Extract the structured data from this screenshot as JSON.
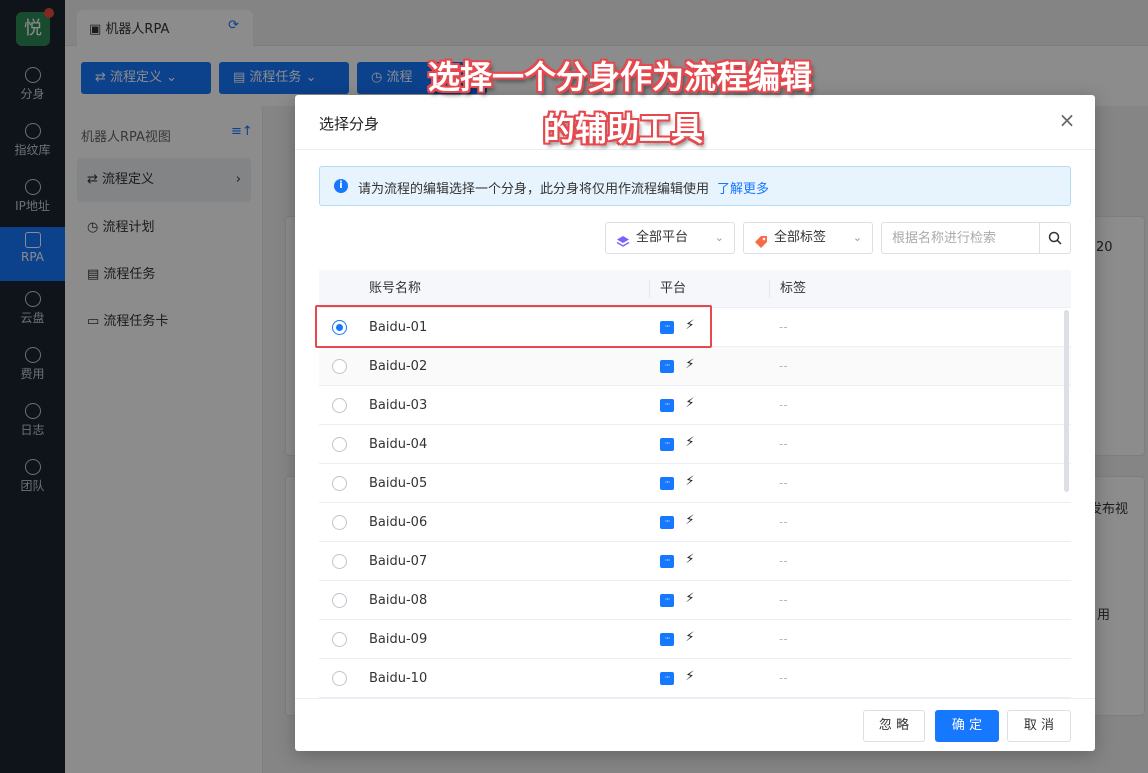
{
  "leftnav": {
    "logo": "悦",
    "items": [
      {
        "label": "分身",
        "icon": "chrome-icon"
      },
      {
        "label": "指纹库",
        "icon": "fingerprint-icon"
      },
      {
        "label": "IP地址",
        "icon": "ip-icon"
      },
      {
        "label": "RPA",
        "icon": "robot-icon",
        "active": true
      },
      {
        "label": "云盘",
        "icon": "cloud-icon"
      },
      {
        "label": "费用",
        "icon": "yen-icon"
      },
      {
        "label": "日志",
        "icon": "log-icon"
      },
      {
        "label": "团队",
        "icon": "team-icon"
      }
    ]
  },
  "tabbar": {
    "tab_label": "机器人RPA"
  },
  "toolbar": {
    "btn1": "流程定义",
    "btn2": "流程任务",
    "btn3": "流程"
  },
  "sidepanel": {
    "title": "机器人RPA视图",
    "items": [
      "流程定义",
      "流程计划",
      "流程任务",
      "流程任务卡"
    ]
  },
  "background_fragments": {
    "t1": "20",
    "t2": "发布视",
    "t3": "用"
  },
  "modal": {
    "title": "选择分身",
    "close": "×",
    "alert_text": "请为流程的编辑选择一个分身，此分身将仅用作流程编辑使用",
    "alert_link": "了解更多",
    "filter_platform": "全部平台",
    "filter_tag": "全部标签",
    "search_placeholder": "根据名称进行检索",
    "columns": {
      "name": "账号名称",
      "platform": "平台",
      "tag": "标签"
    },
    "rows": [
      {
        "name": "Baidu-01",
        "tag": "--",
        "selected": true
      },
      {
        "name": "Baidu-02",
        "tag": "--"
      },
      {
        "name": "Baidu-03",
        "tag": "--"
      },
      {
        "name": "Baidu-04",
        "tag": "--"
      },
      {
        "name": "Baidu-05",
        "tag": "--"
      },
      {
        "name": "Baidu-06",
        "tag": "--"
      },
      {
        "name": "Baidu-07",
        "tag": "--"
      },
      {
        "name": "Baidu-08",
        "tag": "--"
      },
      {
        "name": "Baidu-09",
        "tag": "--"
      },
      {
        "name": "Baidu-10",
        "tag": "--"
      }
    ],
    "buttons": {
      "ignore": "忽 略",
      "confirm": "确 定",
      "cancel": "取 消"
    }
  },
  "annotation": {
    "line1": "选择一个分身作为流程编辑",
    "line2": "的辅助工具"
  },
  "colors": {
    "accent": "#1677ff",
    "highlight": "#e5484d",
    "nav_bg": "#1b2530"
  }
}
